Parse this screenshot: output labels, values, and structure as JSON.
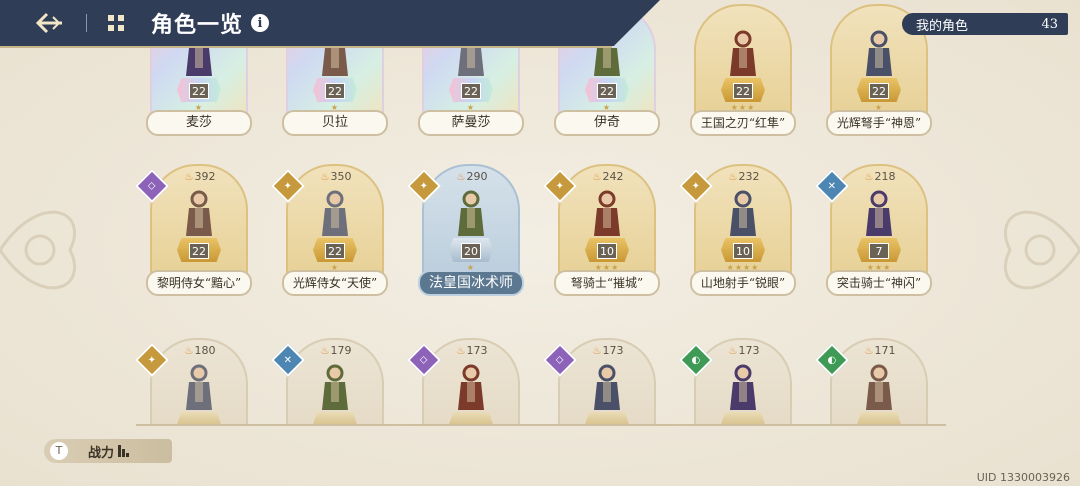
{
  "header": {
    "title": "角色一览",
    "info_icon": "i",
    "my_characters_label": "我的角色",
    "my_characters_count": "43"
  },
  "rows": [
    [
      {
        "name": "麦莎",
        "level": "22",
        "style": "rainbow",
        "stars": "★"
      },
      {
        "name": "贝拉",
        "level": "22",
        "style": "rainbow",
        "stars": "★"
      },
      {
        "name": "萨曼莎",
        "level": "22",
        "style": "rainbow",
        "stars": "★"
      },
      {
        "name": "伊奇",
        "level": "22",
        "style": "rainbow",
        "stars": "★"
      },
      {
        "name": "王国之刃“红隼”",
        "level": "22",
        "style": "gold",
        "stars": "★★★"
      },
      {
        "name": "光辉弩手“神恩”",
        "level": "22",
        "style": "gold",
        "stars": "★"
      }
    ],
    [
      {
        "name": "黎明侍女“黯心”",
        "level": "22",
        "style": "gold",
        "power": "392",
        "element": "dark",
        "stars": ""
      },
      {
        "name": "光辉侍女“天使”",
        "level": "22",
        "style": "gold",
        "power": "350",
        "element": "light",
        "stars": "★"
      },
      {
        "name": "法皇国冰术师",
        "level": "20",
        "style": "blue",
        "power": "290",
        "element": "light",
        "stars": "★"
      },
      {
        "name": "弩骑士“摧城”",
        "level": "10",
        "style": "gold",
        "power": "242",
        "element": "light",
        "stars": "★★★"
      },
      {
        "name": "山地射手“锐眼”",
        "level": "10",
        "style": "gold",
        "power": "232",
        "element": "light",
        "stars": "★★★★"
      },
      {
        "name": "突击骑士“神闪”",
        "level": "7",
        "style": "gold",
        "power": "218",
        "element": "ice",
        "stars": "★★★"
      }
    ],
    [
      {
        "name": "",
        "level": "",
        "style": "plain",
        "power": "180",
        "element": "light"
      },
      {
        "name": "",
        "level": "",
        "style": "plain",
        "power": "179",
        "element": "ice"
      },
      {
        "name": "",
        "level": "",
        "style": "plain",
        "power": "173",
        "element": "dark"
      },
      {
        "name": "",
        "level": "",
        "style": "plain",
        "power": "173",
        "element": "dark"
      },
      {
        "name": "",
        "level": "",
        "style": "plain",
        "power": "173",
        "element": "wind"
      },
      {
        "name": "",
        "level": "",
        "style": "plain",
        "power": "171",
        "element": "wind"
      }
    ]
  ],
  "filter": {
    "badge": "T",
    "label": "战力"
  },
  "footer": {
    "uid": "UID 1330003926"
  },
  "colors": {
    "header_bg": "#2f3d57",
    "parchment": "#efe9dc",
    "gold": "#c69a3c"
  }
}
